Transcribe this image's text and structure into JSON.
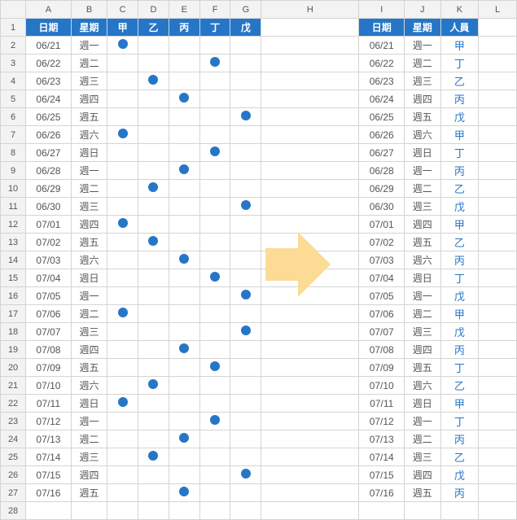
{
  "columns": [
    "A",
    "B",
    "C",
    "D",
    "E",
    "F",
    "G",
    "H",
    "I",
    "J",
    "K",
    "L"
  ],
  "row_count": 28,
  "header_left": {
    "date": "日期",
    "weekday": "星期",
    "people": [
      "甲",
      "乙",
      "丙",
      "丁",
      "戊"
    ]
  },
  "header_right": {
    "date": "日期",
    "weekday": "星期",
    "person": "人員"
  },
  "chart_data": {
    "type": "table",
    "rows": [
      {
        "date": "06/21",
        "weekday": "週一",
        "mark_col": 0,
        "person": "甲"
      },
      {
        "date": "06/22",
        "weekday": "週二",
        "mark_col": 3,
        "person": "丁"
      },
      {
        "date": "06/23",
        "weekday": "週三",
        "mark_col": 1,
        "person": "乙"
      },
      {
        "date": "06/24",
        "weekday": "週四",
        "mark_col": 2,
        "person": "丙"
      },
      {
        "date": "06/25",
        "weekday": "週五",
        "mark_col": 4,
        "person": "戊"
      },
      {
        "date": "06/26",
        "weekday": "週六",
        "mark_col": 0,
        "person": "甲"
      },
      {
        "date": "06/27",
        "weekday": "週日",
        "mark_col": 3,
        "person": "丁"
      },
      {
        "date": "06/28",
        "weekday": "週一",
        "mark_col": 2,
        "person": "丙"
      },
      {
        "date": "06/29",
        "weekday": "週二",
        "mark_col": 1,
        "person": "乙"
      },
      {
        "date": "06/30",
        "weekday": "週三",
        "mark_col": 4,
        "person": "戊"
      },
      {
        "date": "07/01",
        "weekday": "週四",
        "mark_col": 0,
        "person": "甲"
      },
      {
        "date": "07/02",
        "weekday": "週五",
        "mark_col": 1,
        "person": "乙"
      },
      {
        "date": "07/03",
        "weekday": "週六",
        "mark_col": 2,
        "person": "丙"
      },
      {
        "date": "07/04",
        "weekday": "週日",
        "mark_col": 3,
        "person": "丁"
      },
      {
        "date": "07/05",
        "weekday": "週一",
        "mark_col": 4,
        "person": "戊"
      },
      {
        "date": "07/06",
        "weekday": "週二",
        "mark_col": 0,
        "person": "甲"
      },
      {
        "date": "07/07",
        "weekday": "週三",
        "mark_col": 4,
        "person": "戊"
      },
      {
        "date": "07/08",
        "weekday": "週四",
        "mark_col": 2,
        "person": "丙"
      },
      {
        "date": "07/09",
        "weekday": "週五",
        "mark_col": 3,
        "person": "丁"
      },
      {
        "date": "07/10",
        "weekday": "週六",
        "mark_col": 1,
        "person": "乙"
      },
      {
        "date": "07/11",
        "weekday": "週日",
        "mark_col": 0,
        "person": "甲"
      },
      {
        "date": "07/12",
        "weekday": "週一",
        "mark_col": 3,
        "person": "丁"
      },
      {
        "date": "07/13",
        "weekday": "週二",
        "mark_col": 2,
        "person": "丙"
      },
      {
        "date": "07/14",
        "weekday": "週三",
        "mark_col": 1,
        "person": "乙"
      },
      {
        "date": "07/15",
        "weekday": "週四",
        "mark_col": 4,
        "person": "戊"
      },
      {
        "date": "07/16",
        "weekday": "週五",
        "mark_col": 2,
        "person": "丙"
      }
    ]
  }
}
